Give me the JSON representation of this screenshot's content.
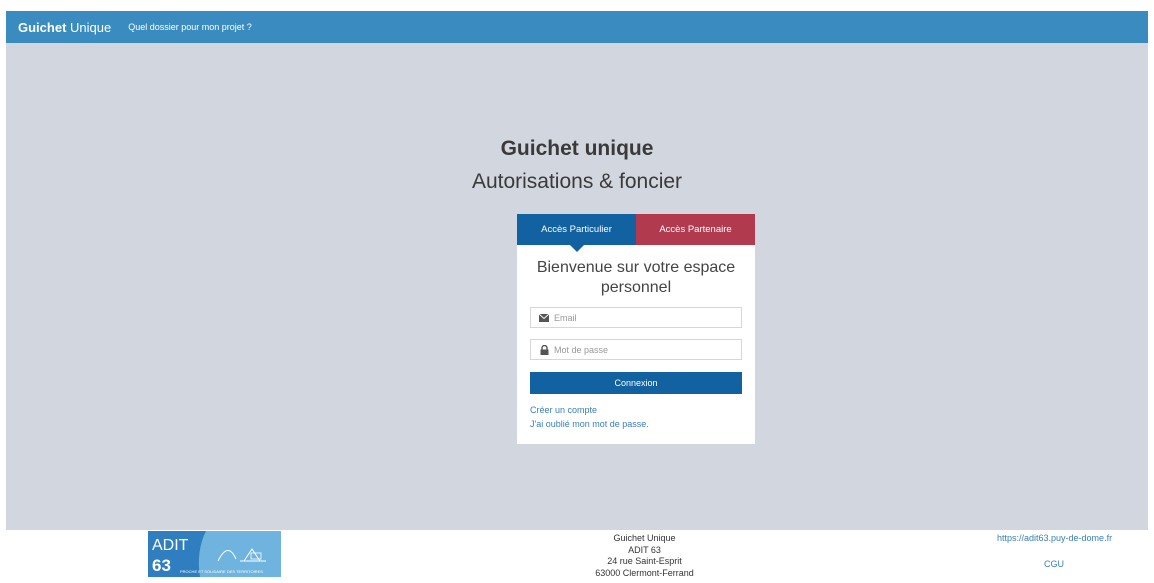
{
  "header": {
    "brand_bold": "Guichet",
    "brand_rest": " Unique",
    "nav_link": "Quel dossier pour mon projet ?"
  },
  "hero": {
    "title": "Guichet unique",
    "subtitle": "Autorisations & foncier"
  },
  "login": {
    "tabs": [
      {
        "label": "Accès Particulier",
        "active": true
      },
      {
        "label": "Accès Partenaire",
        "active": false
      }
    ],
    "welcome": "Bienvenue sur votre espace personnel",
    "email_placeholder": "Email",
    "password_placeholder": "Mot de passe",
    "submit_label": "Connexion",
    "create_account": "Créer un compte",
    "forgot_password": "J'ai oublié mon mot de passe."
  },
  "footer": {
    "logo_text": "ADIT 63",
    "logo_tagline": "PROCHE ET SOLIDAIRE DES TERRITOIRES",
    "address": [
      "Guichet Unique",
      "ADIT 63",
      "24 rue Saint-Esprit",
      "63000 Clermont-Ferrand"
    ],
    "website": "https://adit63.puy-de-dome.fr",
    "cgu": "CGU"
  },
  "colors": {
    "header_bg": "#3a8bc0",
    "page_bg": "#d2d6df",
    "primary": "#1261a0",
    "partner": "#b23a4e",
    "link": "#3a7fb8"
  },
  "icons": {
    "email": "envelope-icon",
    "password": "lock-icon"
  }
}
